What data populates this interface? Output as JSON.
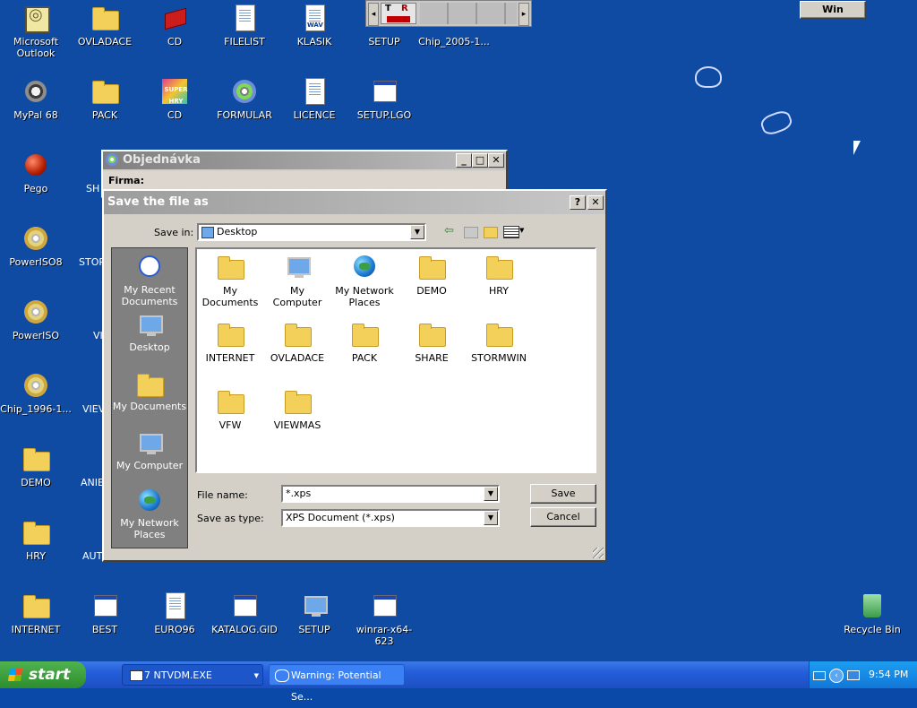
{
  "desktop_icons": {
    "row1": [
      "Microsoft Outlook",
      "OVLADACE",
      "CD",
      "FILELIST",
      "KLASIK",
      "SETUP",
      "Chip_2005-1..."
    ],
    "row2": [
      "MyPal 68",
      "PACK",
      "CD",
      "FORMULAR",
      "LICENCE",
      "SETUP.LGO"
    ],
    "col1": [
      "Pego",
      "PowerISO8",
      "PowerISO",
      "Chip_1996-1...",
      "DEMO",
      "HRY",
      "INTERNET"
    ],
    "col2_partial": [
      "SH",
      "STOR",
      "VI",
      "VIEV",
      "ANIE",
      "AUT"
    ],
    "bottom_row": [
      "BEST",
      "EURO96",
      "KATALOG.GID",
      "SETUP",
      "winrar-x64-623"
    ],
    "recycle_bin": "Recycle Bin",
    "wav_badge": "WAV",
    "super_badge": "SUPER HRY"
  },
  "top_widget": {
    "t_label": "T",
    "r_label": "R",
    "left_arrow": "◂",
    "right_arrow": "▸"
  },
  "win_button": "Win",
  "background_window": {
    "title": "Objednávka",
    "field_label": "Firma:"
  },
  "dialog": {
    "title": "Save the file as",
    "help": "?",
    "close": "✕",
    "save_in_label": "Save in:",
    "save_in_value": "Desktop",
    "places": [
      "My Recent Documents",
      "Desktop",
      "My Documents",
      "My Computer",
      "My Network Places"
    ],
    "files": [
      "My Documents",
      "My Computer",
      "My Network Places",
      "DEMO",
      "HRY",
      "INTERNET",
      "OVLADACE",
      "PACK",
      "SHARE",
      "STORMWIN",
      "VFW",
      "VIEWMAS"
    ],
    "file_name_label": "File name:",
    "file_name_value": "*.xps",
    "save_as_type_label": "Save as type:",
    "save_as_type_value": "XPS Document (*.xps)",
    "save_button": "Save",
    "cancel_button": "Cancel"
  },
  "taskbar": {
    "start": "start",
    "tasks": [
      "7 NTVDM.EXE",
      "Warning: Potential Se..."
    ],
    "clock": "9:54 PM"
  }
}
